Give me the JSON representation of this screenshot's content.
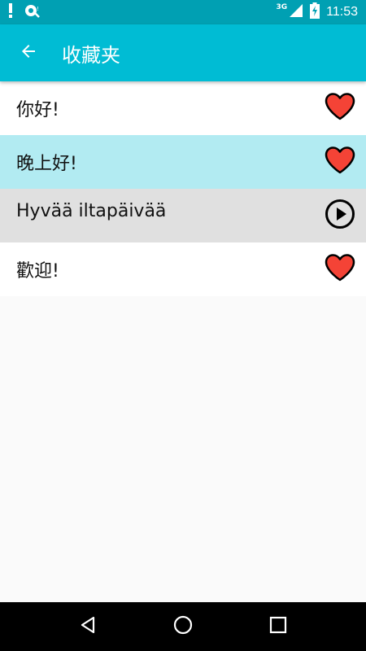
{
  "status_bar": {
    "time": "11:53",
    "network_label": "3G",
    "icons": [
      "notification-alert-icon",
      "sync-icon",
      "signal-icon",
      "battery-charging-icon"
    ]
  },
  "app_bar": {
    "title": "收藏夹",
    "back_icon": "arrow-back-icon"
  },
  "list": {
    "items": [
      {
        "text": "你好!",
        "icon": "heart-icon",
        "background": "#ffffff"
      },
      {
        "text": "晚上好!",
        "icon": "heart-icon",
        "background": "#b2ebf2"
      },
      {
        "text": "Hyvää iltapäivää",
        "icon": "play-icon",
        "background": "#e0e0e0"
      },
      {
        "text": "歡迎!",
        "icon": "heart-icon",
        "background": "#ffffff"
      }
    ]
  },
  "colors": {
    "status_bar": "#00a0b3",
    "app_bar": "#00bcd4",
    "heart": "#f44336",
    "highlight_row": "#b2ebf2",
    "selected_row": "#e0e0e0"
  },
  "nav_bar": {
    "buttons": [
      "back-triangle-icon",
      "home-circle-icon",
      "recents-square-icon"
    ]
  }
}
